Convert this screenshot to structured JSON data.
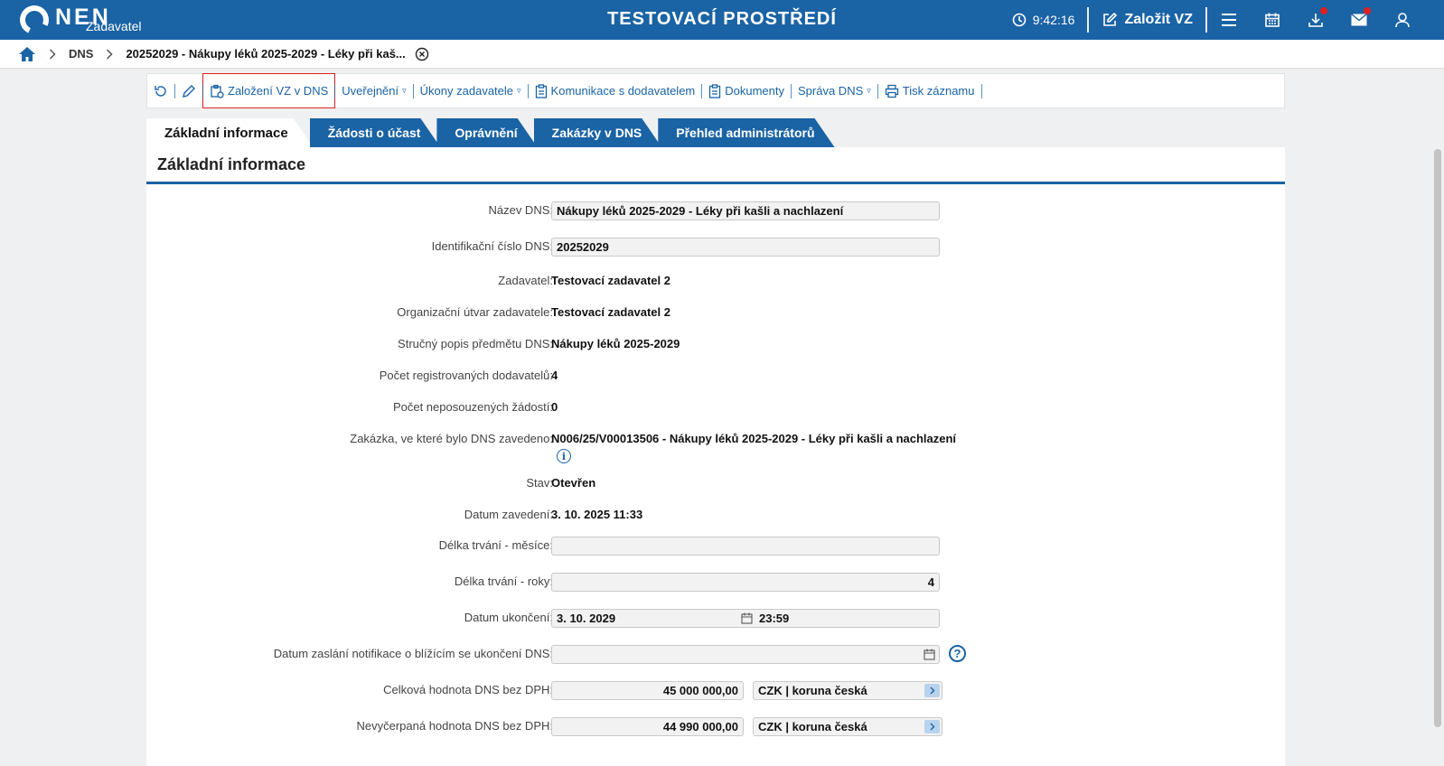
{
  "header": {
    "logo_text": "NEN",
    "logo_sub": "Zadavatel",
    "env_title": "TESTOVACÍ PROSTŘEDÍ",
    "clock": "9:42:16",
    "create_vz": "Založit VZ"
  },
  "breadcrumb": {
    "dns": "DNS",
    "current": "20252029 - Nákupy léků 2025-2029 - Léky při kaš..."
  },
  "toolbar": {
    "zalozeni": "Založení VZ v DNS",
    "uverejneni": "Uveřejnění",
    "ukony": "Úkony zadavatele",
    "komunikace": "Komunikace s dodavatelem",
    "dokumenty": "Dokumenty",
    "sprava": "Správa DNS",
    "tisk": "Tisk záznamu",
    "caret": "▿"
  },
  "tabs": [
    {
      "label": "Základní informace"
    },
    {
      "label": "Žádosti o účast"
    },
    {
      "label": "Oprávnění"
    },
    {
      "label": "Zakázky v DNS"
    },
    {
      "label": "Přehled administrátorů"
    }
  ],
  "panel": {
    "title": "Základní informace"
  },
  "form": {
    "nazev": {
      "label": "Název DNS:",
      "value": "Nákupy léků 2025-2029 - Léky při kašli a nachlazení"
    },
    "id": {
      "label": "Identifikační číslo DNS:",
      "value": "20252029"
    },
    "zadavatel": {
      "label": "Zadavatel:",
      "value": "Testovací zadavatel 2"
    },
    "utvar": {
      "label": "Organizační útvar zadavatele:",
      "value": "Testovací zadavatel 2"
    },
    "popis": {
      "label": "Stručný popis předmětu DNS:",
      "value": "Nákupy léků 2025-2029"
    },
    "pocet_dod": {
      "label": "Počet registrovaných dodavatelů:",
      "value": "4"
    },
    "pocet_zad": {
      "label": "Počet neposouzených žádostí:",
      "value": "0"
    },
    "zakazka": {
      "label": "Zakázka, ve které bylo DNS zavedeno:",
      "value": "N006/25/V00013506 - Nákupy léků 2025-2029 - Léky při kašli a nachlazení",
      "info": "i"
    },
    "stav": {
      "label": "Stav:",
      "value": "Otevřen"
    },
    "datum_zav": {
      "label": "Datum zavedení:",
      "value": "3. 10. 2025 11:33"
    },
    "delka_mes": {
      "label": "Délka trvání - měsíce:",
      "value": ""
    },
    "delka_rok": {
      "label": "Délka trvání - roky:",
      "value": "4"
    },
    "datum_ukon": {
      "label": "Datum ukončení:",
      "date": "3. 10. 2029",
      "time": "23:59"
    },
    "notifikace": {
      "label": "Datum zaslání notifikace o blížícím se ukončení DNS:",
      "value": "",
      "help": "?"
    },
    "celkova": {
      "label": "Celková hodnota DNS bez DPH:",
      "value": "45 000 000,00",
      "currency": "CZK | koruna česká"
    },
    "nevycerpana": {
      "label": "Nevyčerpaná hodnota DNS bez DPH:",
      "value": "44 990 000,00",
      "currency": "CZK | koruna česká"
    }
  }
}
